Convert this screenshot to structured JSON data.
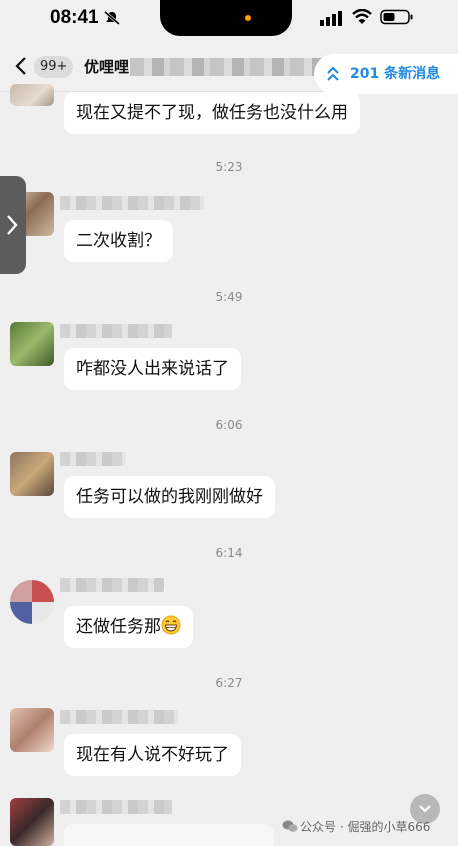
{
  "status_bar": {
    "time": "08:41"
  },
  "nav": {
    "back_badge": "99+",
    "title": "优哩哩"
  },
  "new_messages": {
    "label": "201 条新消息"
  },
  "messages": [
    {
      "text": "现在又提不了现，做任务也没什么用"
    },
    {
      "timestamp": "5:23",
      "text": "二次收割？"
    },
    {
      "timestamp": "5:49",
      "text": "咋都没人出来说话了"
    },
    {
      "timestamp": "6:06",
      "text": "任务可以做的我刚刚做好"
    },
    {
      "timestamp": "6:14",
      "text": "还做任务那"
    },
    {
      "timestamp": "6:27",
      "text": "现在有人说不好玩了"
    }
  ],
  "watermark": {
    "text": "公众号 · 倔强的小草666"
  },
  "colors": {
    "accent": "#1e8ae6",
    "background": "#efefef",
    "bubble": "#ffffff"
  }
}
